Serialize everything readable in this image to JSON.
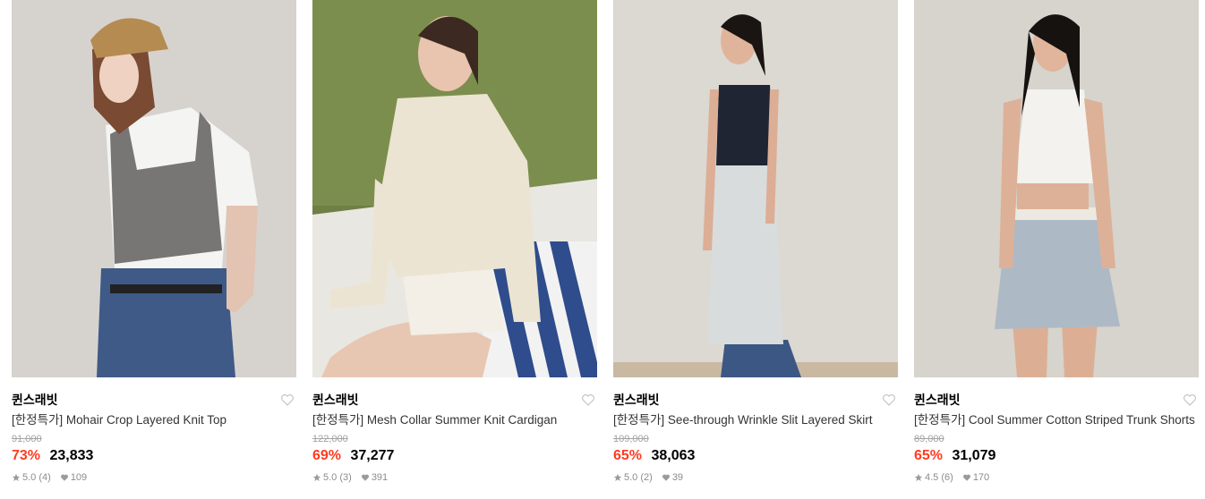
{
  "products": [
    {
      "brand": "퀸스래빗",
      "title": "[한정특가] Mohair Crop Layered Knit Top",
      "original_price": "91,000",
      "discount": "73%",
      "price": "23,833",
      "rating": "5.0",
      "reviews": "(4)",
      "likes": "109"
    },
    {
      "brand": "퀸스래빗",
      "title": "[한정특가] Mesh Collar Summer Knit Cardigan",
      "original_price": "122,000",
      "discount": "69%",
      "price": "37,277",
      "rating": "5.0",
      "reviews": "(3)",
      "likes": "391"
    },
    {
      "brand": "퀸스래빗",
      "title": "[한정특가] See-through Wrinkle Slit Layered Skirt",
      "original_price": "109,000",
      "discount": "65%",
      "price": "38,063",
      "rating": "5.0",
      "reviews": "(2)",
      "likes": "39"
    },
    {
      "brand": "퀸스래빗",
      "title": "[한정특가] Cool Summer Cotton Striped Trunk Shorts",
      "original_price": "89,000",
      "discount": "65%",
      "price": "31,079",
      "rating": "4.5",
      "reviews": "(6)",
      "likes": "170"
    }
  ],
  "colors": {
    "discount": "#ff3b1f",
    "muted": "#8c8c8c",
    "strike": "#a3a3a3"
  }
}
